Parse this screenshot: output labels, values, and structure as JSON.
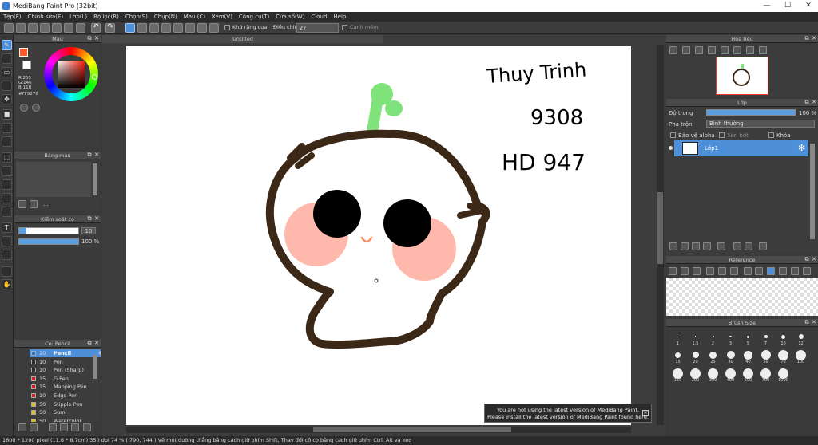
{
  "window": {
    "title": "MediBang Paint Pro (32bit)",
    "min_glyph": "—",
    "max_glyph": "☐",
    "close_glyph": "✕"
  },
  "menu": [
    "Tệp(F)",
    "Chỉnh sửa(E)",
    "Lớp(L)",
    "Bộ lọc(R)",
    "Chọn(S)",
    "Chụp(N)",
    "Màu (C)",
    "Xem(V)",
    "Công cụ(T)",
    "Cửa sổ(W)",
    "Cloud",
    "Help"
  ],
  "toolbar": {
    "antialias_label": "Khử răng cưa",
    "adjust_label": "Điều chỉnh",
    "adjust_value": "27",
    "edge_label": "Cạnh mềm"
  },
  "color_panel": {
    "title": "Màu",
    "r": "R:255",
    "g": "G:146",
    "b": "B:118",
    "hex": "#FF9276",
    "primary_color": "#ff5a2a",
    "secondary_color": "#ffffff"
  },
  "palette_panel": {
    "title": "Bảng màu",
    "more": "…"
  },
  "brush_control": {
    "title": "Kiểm soát cọ",
    "size_value": "10",
    "opacity_value": "100 %",
    "size_fraction": 0.12,
    "opacity_fraction": 1.0
  },
  "brush_list": {
    "title": "Cọ: Pencil",
    "items": [
      {
        "size": "10",
        "name": "Pencil",
        "color": "#2b6ec4",
        "selected": true
      },
      {
        "size": "10",
        "name": "Pen",
        "color": "#2a2a2a",
        "selected": false
      },
      {
        "size": "10",
        "name": "Pen (Sharp)",
        "color": "#2a2a2a",
        "selected": false
      },
      {
        "size": "15",
        "name": "G Pen",
        "color": "#d02020",
        "selected": false
      },
      {
        "size": "15",
        "name": "Mapping Pen",
        "color": "#d02020",
        "selected": false
      },
      {
        "size": "10",
        "name": "Edge Pen",
        "color": "#d02020",
        "selected": false
      },
      {
        "size": "50",
        "name": "Stipple Pen",
        "color": "#e0c020",
        "selected": false
      },
      {
        "size": "50",
        "name": "Sumi",
        "color": "#e0c020",
        "selected": false
      },
      {
        "size": "50",
        "name": "Watercolor",
        "color": "#e0c020",
        "selected": false
      }
    ]
  },
  "canvas": {
    "tab_title": "Untitled",
    "text_line1": "Thuy Trinh",
    "text_line2": "9308",
    "text_line3": "HD 947"
  },
  "notification": {
    "line1": "You are not using the latest version of MediBang Paint.",
    "line2": "Please install the latest version of MediBang Paint found here.",
    "close_glyph": "✕"
  },
  "navigator": {
    "title": "Hoa tiêu"
  },
  "layers": {
    "title": "Lớp",
    "opacity_label": "Độ trong",
    "opacity_value": "100 %",
    "opacity_fraction": 1.0,
    "blend_label": "Pha trộn",
    "blend_value": "Bình thường",
    "protect_alpha": "Bảo vệ alpha",
    "clipping": "Xén bớt",
    "lock": "Khóa",
    "layer_name": "Lớp1"
  },
  "reference": {
    "title": "Reference"
  },
  "brush_size": {
    "title": "Brush Size",
    "sizes": [
      "1",
      "1.5",
      "2",
      "3",
      "5",
      "7",
      "10",
      "12",
      "15",
      "20",
      "25",
      "30",
      "40",
      "50",
      "70",
      "100",
      "150",
      "200",
      "300",
      "400",
      "500",
      "700",
      "1000"
    ],
    "dot_sizes": [
      1,
      1.5,
      2,
      2.5,
      3,
      4,
      5,
      6,
      7,
      8,
      9,
      10,
      11,
      12,
      13,
      13,
      13,
      13,
      13,
      13,
      13,
      13,
      13
    ]
  },
  "status": {
    "text": "1600 * 1200 pixel   (11.6 * 8.7cm)   350 dpi   74 %   ( 790, 744 )   Vẽ một đường thẳng bằng cách giữ phím Shift, Thay đổi cỡ cọ bằng cách giữ phím Ctrl, Alt và kéo"
  }
}
